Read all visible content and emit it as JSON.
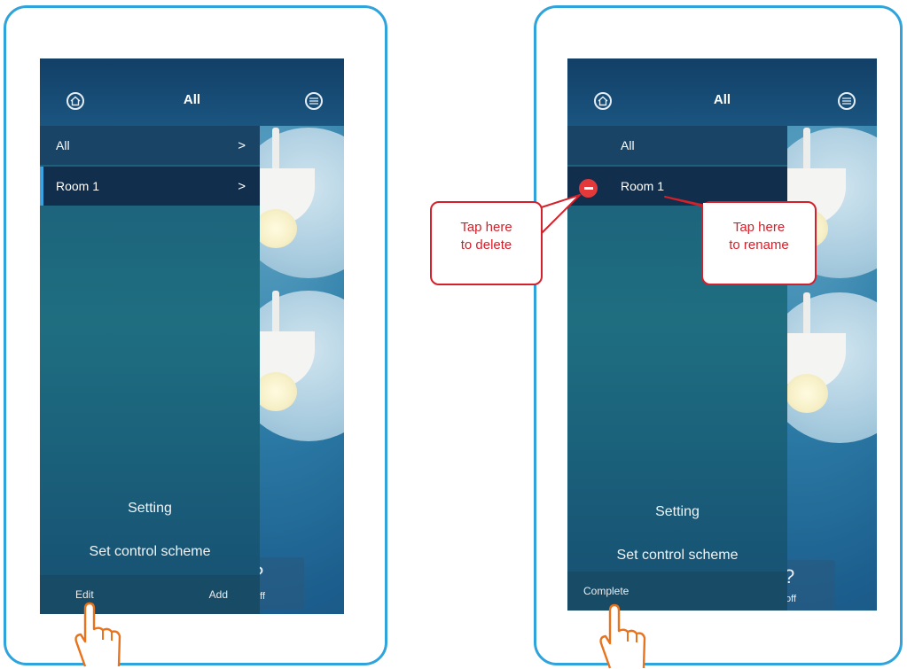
{
  "left_screen": {
    "header": {
      "title": "All"
    },
    "drawer": {
      "items": [
        {
          "label": "All",
          "chevron": ">"
        },
        {
          "label": "Room 1",
          "chevron": ">"
        }
      ],
      "setting": "Setting",
      "control_scheme": "Set control scheme",
      "edit_label": "Edit",
      "add_label": "Add"
    },
    "background_card": {
      "text": "off"
    }
  },
  "right_screen": {
    "header": {
      "title": "All"
    },
    "drawer": {
      "items": [
        {
          "label": "All"
        },
        {
          "label": "Room 1"
        }
      ],
      "setting": "Setting",
      "control_scheme": "Set control scheme",
      "complete_label": "Complete"
    },
    "background_card": {
      "text": "off"
    }
  },
  "callouts": {
    "delete": {
      "line1": "Tap here",
      "line2": "to delete"
    },
    "rename": {
      "line1": "Tap here",
      "line2": "to rename"
    }
  },
  "colors": {
    "frame_border": "#2ea3dc",
    "callout_red": "#d3202a",
    "selection_bar": "#3aa2e0",
    "hand_outline": "#e8731c"
  }
}
